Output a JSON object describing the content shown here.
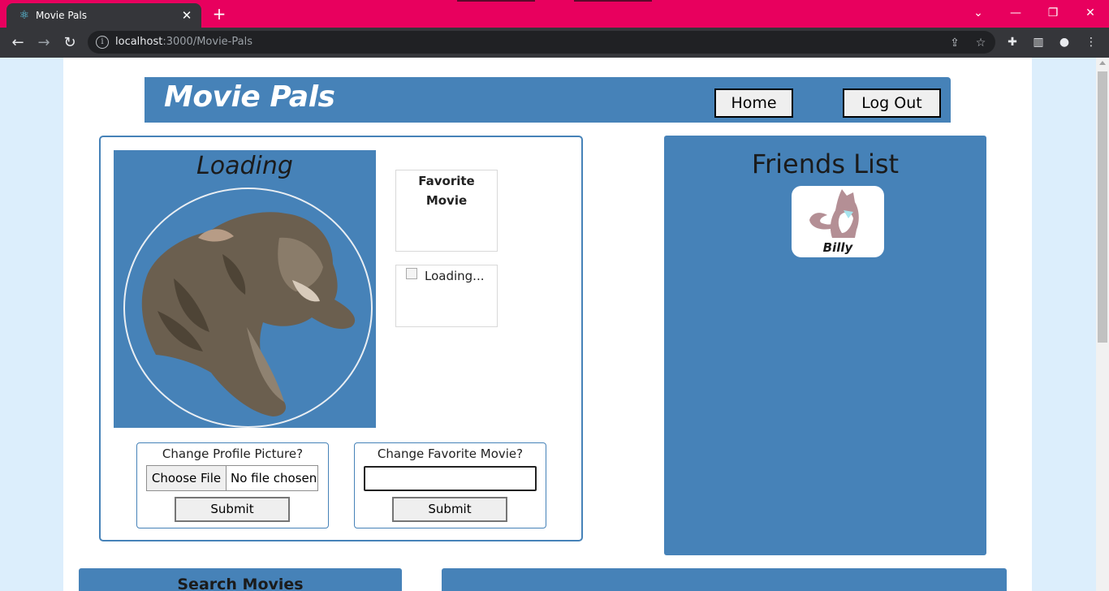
{
  "browser": {
    "tab_title": "Movie Pals",
    "tab_close": "✕",
    "new_tab": "+",
    "url_host": "localhost",
    "url_path": ":3000/Movie-Pals"
  },
  "header": {
    "brand": "Movie Pals",
    "home_label": "Home",
    "logout_label": "Log Out"
  },
  "profile": {
    "name": "Loading",
    "favorite_movie_label_line1": "Favorite",
    "favorite_movie_label_line2": "Movie",
    "poster_alt": "Loading..."
  },
  "forms": {
    "picture": {
      "label": "Change Profile Picture?",
      "choose_file": "Choose File",
      "file_status": "No file chosen",
      "submit": "Submit"
    },
    "movie": {
      "label": "Change Favorite Movie?",
      "value": "",
      "submit": "Submit"
    }
  },
  "friends": {
    "heading": "Friends List",
    "items": [
      {
        "name": "Billy"
      }
    ]
  },
  "search": {
    "heading": "Search Movies"
  },
  "colors": {
    "accent": "#4682b8",
    "tabbar": "#e8005e",
    "chrome": "#35363a"
  }
}
